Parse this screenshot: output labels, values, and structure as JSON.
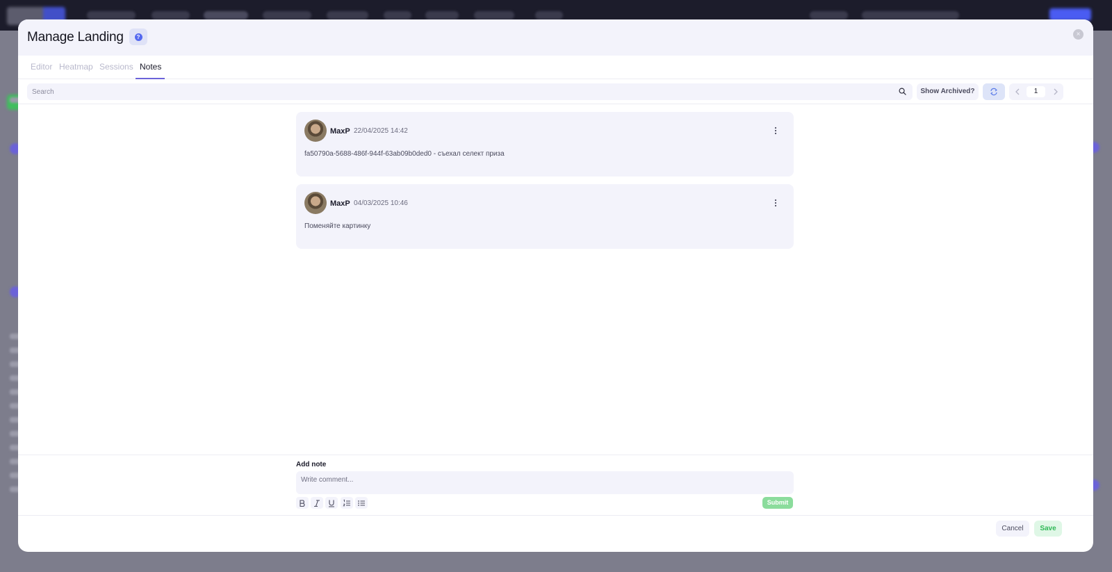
{
  "modal": {
    "title": "Manage Landing",
    "help_icon_label": "?",
    "close_icon_label": "×"
  },
  "tabs": [
    {
      "label": "Editor",
      "active": false
    },
    {
      "label": "Heatmap",
      "active": false
    },
    {
      "label": "Sessions",
      "active": false
    },
    {
      "label": "Notes",
      "active": true
    }
  ],
  "toolbar": {
    "search_placeholder": "Search",
    "show_archived_label": "Show Archived?",
    "page_number": "1"
  },
  "notes": [
    {
      "author": "MaxP",
      "date": "22/04/2025 14:42",
      "text": "fa50790a-5688-486f-944f-63ab09b0ded0 - съехал селект приза"
    },
    {
      "author": "MaxP",
      "date": "04/03/2025 10:46",
      "text": "Поменяйте картинку"
    }
  ],
  "composer": {
    "label": "Add note",
    "placeholder": "Write comment...",
    "submit_label": "Submit",
    "format_tools": [
      "bold-icon",
      "italic-icon",
      "underline-icon",
      "ordered-list-icon",
      "bullet-list-icon"
    ]
  },
  "footer": {
    "cancel_label": "Cancel",
    "save_label": "Save"
  },
  "colors": {
    "accent": "#6b63d9",
    "submit": "#8bdc9c",
    "save_text": "#2fb856"
  }
}
